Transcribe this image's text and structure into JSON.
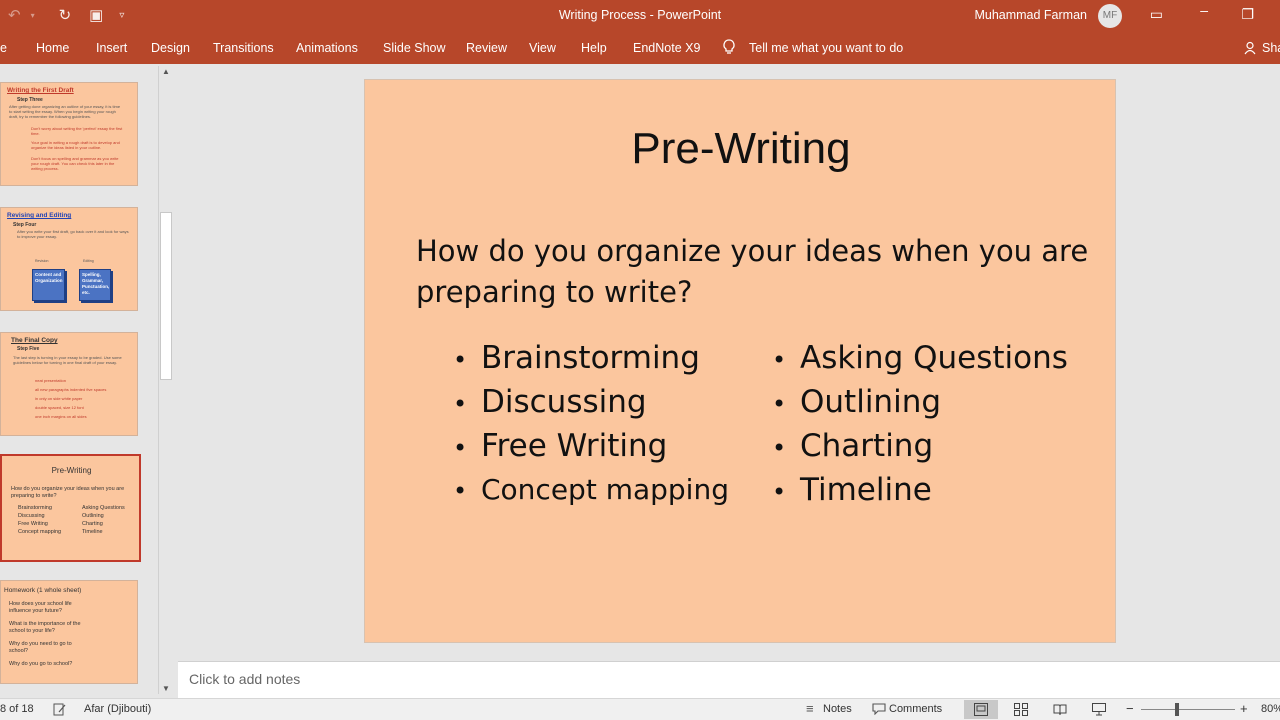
{
  "titlebar": {
    "title": "Writing Process  -  PowerPoint",
    "user": "Muhammad Farman",
    "avatar": "MF",
    "icons": [
      "undo-icon",
      "redo-icon",
      "start-from-beginning-icon",
      "customize-qat-icon"
    ]
  },
  "ribbon": {
    "tabs": [
      "Home",
      "Insert",
      "Design",
      "Transitions",
      "Animations",
      "Slide Show",
      "Review",
      "View",
      "Help",
      "EndNote X9"
    ],
    "tell_me": "Tell me what you want to do",
    "share": "Sha"
  },
  "thumbnails": [
    {
      "title": "Writing the First Draft",
      "step": "Step Three",
      "intro": "After getting done organizing an outline of your essay, it is time to start writing the essay. When you begin writing your rough draft, try to remember the following guidelines.",
      "bullets": [
        "Don't worry about writing the 'perfect' essay the first time.",
        "Your goal in writing a rough draft is to develop and organize the ideas listed in your outline.",
        "Don't focus on spelling and grammar as you write your rough draft. You can check this later in the writing process."
      ]
    },
    {
      "title": "Revising and Editing",
      "step": "Step Four",
      "intro": "After you write your first draft, go back over it and look for ways to improve your essay.",
      "left_label": "Revision",
      "right_label": "Editing",
      "box1": "Content and Organization",
      "box2": "Spelling, Grammar, Punctuation, etc."
    },
    {
      "title": "The Final Copy",
      "step": "Step Five",
      "intro": "The last step is turning in your essay to be graded. Use some guidelines below for turning in one final draft of your essay.",
      "bullets": [
        "neat presentation",
        "all new paragraphs indented five spaces",
        "in only on side white paper",
        "double spaced, size 12 font",
        "one inch margins on all sides"
      ]
    },
    {
      "title": "Pre-Writing",
      "question": "How do you organize your ideas when you are preparing to write?",
      "left": [
        "Brainstorming",
        "Discussing",
        "Free Writing",
        "Concept mapping"
      ],
      "right": [
        "Asking Questions",
        "Outlining",
        "Charting",
        "Timeline"
      ]
    },
    {
      "title": "Homework (1 whole sheet)",
      "questions": [
        "How does your school life influence your future?",
        "What is the importance of the school to your life?",
        "Why do you need to go to school?",
        "Why do you go to school?"
      ]
    }
  ],
  "slide": {
    "title": "Pre-Writing",
    "question": "How do you organize your ideas when you are preparing to write?",
    "left": [
      "Brainstorming",
      "Discussing",
      "Free Writing",
      "Concept mapping"
    ],
    "right": [
      "Asking Questions",
      "Outlining",
      "Charting",
      "Timeline"
    ]
  },
  "notes": {
    "placeholder": "Click to add notes"
  },
  "status": {
    "slide_count": "8 of 18",
    "language": "Afar (Djibouti)",
    "notes_label": "Notes",
    "comments_label": "Comments",
    "zoom_minus": "−",
    "zoom_plus": "+",
    "zoom": "80%"
  },
  "colors": {
    "accent": "#b7472a",
    "slide_bg": "#fbc69e"
  }
}
